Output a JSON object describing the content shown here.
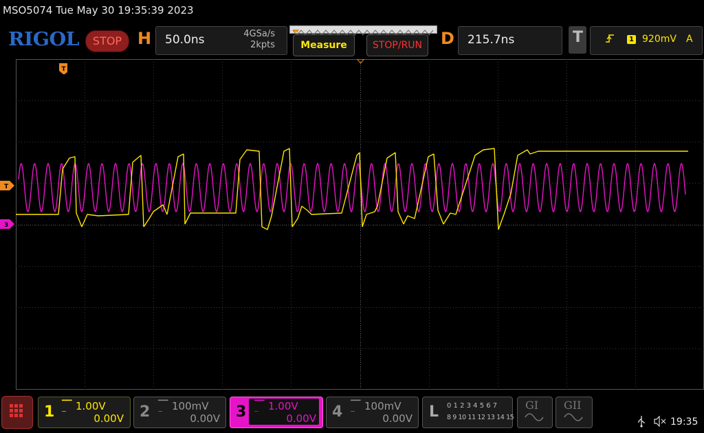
{
  "header": {
    "title": "MSO5074  Tue May 30 19:35:39 2023",
    "logo_text": "RIGOL",
    "run_state": "STOP"
  },
  "horizontal": {
    "letter": "H",
    "timebase": "50.0ns",
    "sample_rate": "4GSa/s",
    "mem_depth": "2kpts"
  },
  "buttons": {
    "measure": "Measure",
    "stop_run": "STOP/RUN"
  },
  "delay": {
    "letter": "D",
    "value": "215.7ns"
  },
  "trigger": {
    "letter": "T",
    "source": "1",
    "level": "920mV",
    "mode": "A",
    "edge_icon": "rising-edge-icon"
  },
  "markers": {
    "trigger_pos": "T",
    "trigger_level": "T",
    "ch3_ground": "3"
  },
  "channels": [
    {
      "num": "1",
      "scale": "1.00V",
      "offset": "0.00V",
      "color": "#ffe600",
      "active": false
    },
    {
      "num": "2",
      "scale": "100mV",
      "offset": "0.00V",
      "color": "#888888",
      "active": false
    },
    {
      "num": "3",
      "scale": "1.00V",
      "offset": "0.00V",
      "color": "#ffe600",
      "active": true
    },
    {
      "num": "4",
      "scale": "100mV",
      "offset": "0.00V",
      "color": "#888888",
      "active": false
    }
  ],
  "logic": {
    "letter": "L",
    "row1": "0 1 2 3  4 5 6 7",
    "row2": "8 9 10 11  12 13 14 15"
  },
  "generators": {
    "g1": "GI",
    "g2": "GII"
  },
  "status": {
    "time": "19:35"
  },
  "colors": {
    "ch1": "#ffe600",
    "ch3": "#e614c8",
    "accent_orange": "#f08a1e",
    "grid": "#3a3a3a"
  }
}
